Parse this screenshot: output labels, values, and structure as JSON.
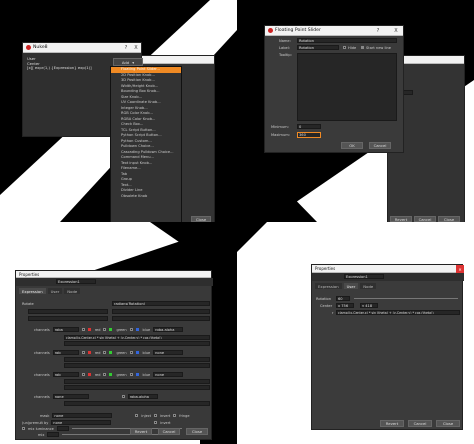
{
  "colors": {
    "accent": "#f08a24",
    "panel": "#3a3a3a",
    "field": "#262626"
  },
  "q1": {
    "nukeDialog": {
      "title": "Nuke8",
      "text": [
        "User",
        "Center",
        "[x][ expr(1,) {Expression} exp(1)]"
      ],
      "help": "?",
      "close": "X"
    },
    "addButton": "Add",
    "menuItems": [
      "Floating Point Slider...",
      "2D Position Knob...",
      "3D Position Knob...",
      "Width/Height Knob...",
      "Bounding Box Knob...",
      "Size Knob...",
      "UV Coordinate Knob...",
      "Integer Knob...",
      "RGB Color Knob...",
      "RGBA Color Knob...",
      "Check Box...",
      "TCL Script Button...",
      "Python Script Button...",
      "Python Custom...",
      "Pulldown Choice...",
      "Cascading Pulldown Choice...",
      "Command Menu...",
      "Text input Knob...",
      "Filename...",
      "Tab",
      "Group",
      "Text...",
      "Divider Line",
      "Obsolete Knob"
    ],
    "closeButton": "Close"
  },
  "q2": {
    "title": "Floating Point Slider",
    "help": "?",
    "close": "X",
    "nameLabel": "Name:",
    "nameValue": "Rotation",
    "labelLabel": "Label:",
    "labelValue": "Rotation",
    "hideLabel": "Hide",
    "newLineLabel": "Start new line",
    "tooltipLabel": "Tooltip:",
    "minLabel": "Minimum:",
    "minValue": "0",
    "maxLabel": "Maximum:",
    "maxValue": "360",
    "ok": "OK",
    "cancel": "Cancel",
    "revert": "Revert",
    "closeBtn": "Close",
    "bgExpr": "200"
  },
  "q3": {
    "title": "Properties",
    "nodeName": "Expression1",
    "tabs": [
      "Expression",
      "User",
      "Node"
    ],
    "rotationLabel": "Rotate",
    "rotationExpr": "radians(Rotation)",
    "channelsLabel": "channels",
    "rows": [
      {
        "label": "channels",
        "value": "rgba",
        "chans": [
          "red",
          "green",
          "blue",
          "rgba.alpha"
        ],
        "expr": "clamp((x-Center.x) * sin (theta) + (y-Center.y) * cos (theta))"
      },
      {
        "label": "channels",
        "value": "rgb",
        "chans": [
          "red",
          "green",
          "blue",
          "none"
        ],
        "expr": ""
      },
      {
        "label": "channels",
        "value": "rgb",
        "chans": [
          "red",
          "green",
          "blue",
          "none"
        ],
        "expr": ""
      },
      {
        "label": "channels",
        "value": "none",
        "chans": [
          "rgba.alpha"
        ],
        "expr": ""
      }
    ],
    "maskLabel": "mask",
    "maskValue": "none",
    "injectLabel": "inject",
    "invertLabel": "invert",
    "fringeLabel": "fringe",
    "unpremultLabel": "(un)premult by",
    "unpremultValue": "none",
    "mixLumLabel": "mix luminance",
    "mixLabel": "mix",
    "revert": "Revert",
    "cancel": "Cancel",
    "close": "Close"
  },
  "centerLabel": "center",
  "q4": {
    "title": "Properties",
    "nodeName": "Expression1",
    "tabs": [
      "Expression",
      "User",
      "Node"
    ],
    "rotationLabel": "Rotation",
    "rotationValue": "60",
    "centerLabel": "Center",
    "centerX": "x 756",
    "centerY": "y 418",
    "exprPrefix": "r",
    "exprValue": "clamp((x-Center.x) * sin (theta) + (y-Center.y) * cos (theta))",
    "revert": "Revert",
    "cancel": "Cancel",
    "close": "Close"
  }
}
